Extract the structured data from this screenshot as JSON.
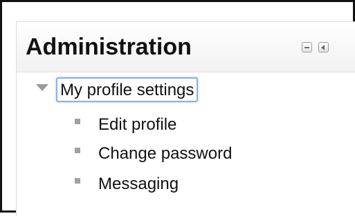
{
  "block": {
    "title": "Administration",
    "controls": [
      {
        "name": "hide",
        "icon": "minus-icon"
      },
      {
        "name": "dock",
        "icon": "chevron-left-icon"
      }
    ]
  },
  "tree": {
    "branch": {
      "label": "My profile settings",
      "expanded": true,
      "focused": true,
      "toggle_icon": "triangle-down-icon"
    },
    "items": [
      {
        "label": "Edit profile",
        "icon": "square-bullet-icon"
      },
      {
        "label": "Change password",
        "icon": "square-bullet-icon"
      },
      {
        "label": "Messaging",
        "icon": "square-bullet-icon"
      }
    ]
  },
  "colors": {
    "focus_outline": "#8ab0e6",
    "bullet": "#a0a0a0",
    "text": "#111111"
  }
}
